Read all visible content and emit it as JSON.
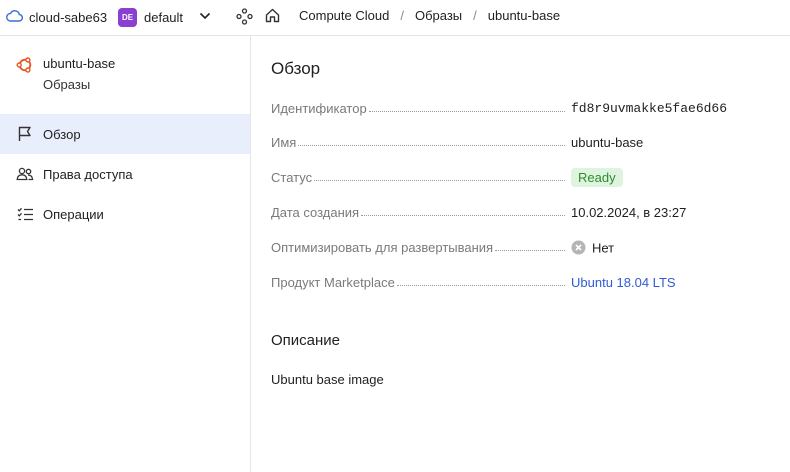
{
  "topbar": {
    "cloud_name": "cloud-sabe63",
    "folder_badge": "DE",
    "folder_name": "default",
    "breadcrumbs": [
      "Compute Cloud",
      "Образы",
      "ubuntu-base"
    ],
    "separator": "/"
  },
  "sidebar": {
    "resource_name": "ubuntu-base",
    "resource_type": "Образы",
    "items": [
      {
        "label": "Обзор",
        "icon": "flag-icon",
        "active": true
      },
      {
        "label": "Права доступа",
        "icon": "users-icon",
        "active": false
      },
      {
        "label": "Операции",
        "icon": "list-check-icon",
        "active": false
      }
    ]
  },
  "overview": {
    "title": "Обзор",
    "fields": {
      "id_label": "Идентификатор",
      "id_value": "fd8r9uvmakke5fae6d66",
      "name_label": "Имя",
      "name_value": "ubuntu-base",
      "status_label": "Статус",
      "status_value": "Ready",
      "created_label": "Дата создания",
      "created_value": "10.02.2024, в 23:27",
      "optimize_label": "Оптимизировать для развертывания",
      "optimize_value": "Нет",
      "product_label": "Продукт Marketplace",
      "product_value": "Ubuntu 18.04 LTS"
    }
  },
  "description": {
    "title": "Описание",
    "text": "Ubuntu base image"
  },
  "colors": {
    "accent": "#2f5bd3",
    "active_nav_bg": "#e8eefb",
    "status_bg": "#dff4df",
    "status_text": "#2e8b2e",
    "ubuntu_orange": "#e95420",
    "folder_badge_bg": "#8a3fd1"
  }
}
